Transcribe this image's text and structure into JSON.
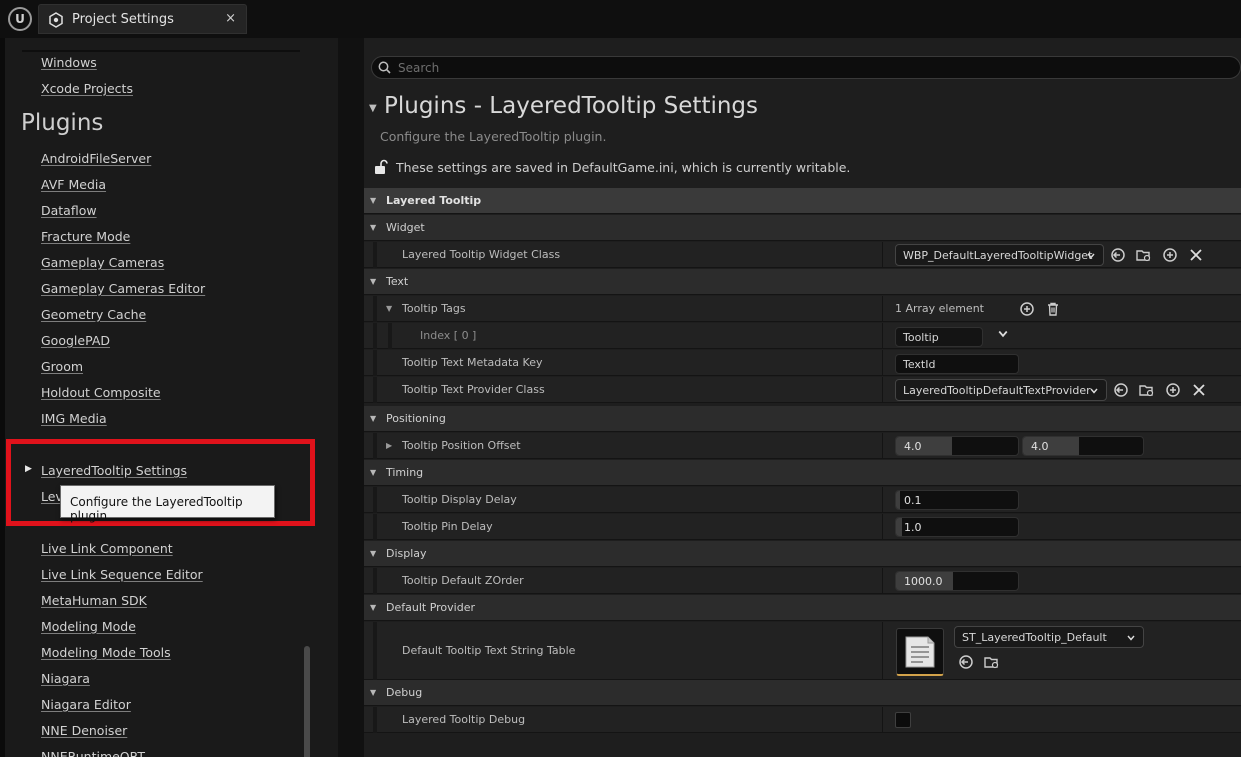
{
  "window": {
    "tab_title": "Project Settings",
    "close_glyph": "×",
    "logo_glyph": "U"
  },
  "sidebar": {
    "links_top": [
      "Windows",
      "Xcode Projects"
    ],
    "heading": "Plugins",
    "plugin_links": [
      "AndroidFileServer",
      "AVF Media",
      "Dataflow",
      "Fracture Mode",
      "Gameplay Cameras",
      "Gameplay Cameras Editor",
      "Geometry Cache",
      "GooglePAD",
      "Groom",
      "Holdout Composite",
      "IMG Media"
    ],
    "selected": "LayeredTooltip Settings",
    "partial_link": "Lev",
    "links_bottom": [
      "Live Link Component",
      "Live Link Sequence Editor",
      "MetaHuman SDK",
      "Modeling Mode",
      "Modeling Mode Tools",
      "Niagara",
      "Niagara Editor",
      "NNE Denoiser",
      "NNERuntimeORT"
    ],
    "tooltip": "Configure the LayeredTooltip plugin.",
    "highlight_color": "#e0121b"
  },
  "details": {
    "search_placeholder": "Search",
    "title": "Plugins - LayeredTooltip Settings",
    "description": "Configure the LayeredTooltip plugin.",
    "save_note": "These settings are saved in DefaultGame.ini, which is currently writable.",
    "category": "Layered Tooltip",
    "sections": {
      "widget": "Widget",
      "text": "Text",
      "positioning": "Positioning",
      "timing": "Timing",
      "display": "Display",
      "default_provider": "Default Provider",
      "debug": "Debug"
    },
    "props": {
      "widget_class": {
        "label": "Layered Tooltip Widget Class",
        "value": "WBP_DefaultLayeredTooltipWidget"
      },
      "tooltip_tags": {
        "label": "Tooltip Tags",
        "value": "1 Array element"
      },
      "tags_index0": {
        "label": "Index [ 0 ]",
        "value": "Tooltip"
      },
      "metadata_key": {
        "label": "Tooltip Text Metadata Key",
        "value": "TextId"
      },
      "provider_class": {
        "label": "Tooltip Text Provider Class",
        "value": "LayeredTooltipDefaultTextProvider"
      },
      "position_offset": {
        "label": "Tooltip Position Offset",
        "x": "4.0",
        "y": "4.0"
      },
      "display_delay": {
        "label": "Tooltip Display Delay",
        "value": "0.1"
      },
      "pin_delay": {
        "label": "Tooltip Pin Delay",
        "value": "1.0"
      },
      "zorder": {
        "label": "Tooltip Default ZOrder",
        "value": "1000.0"
      },
      "string_table": {
        "label": "Default Tooltip Text String Table",
        "value": "ST_LayeredTooltip_Default"
      },
      "debug": {
        "label": "Layered Tooltip Debug",
        "checked": false
      }
    }
  }
}
